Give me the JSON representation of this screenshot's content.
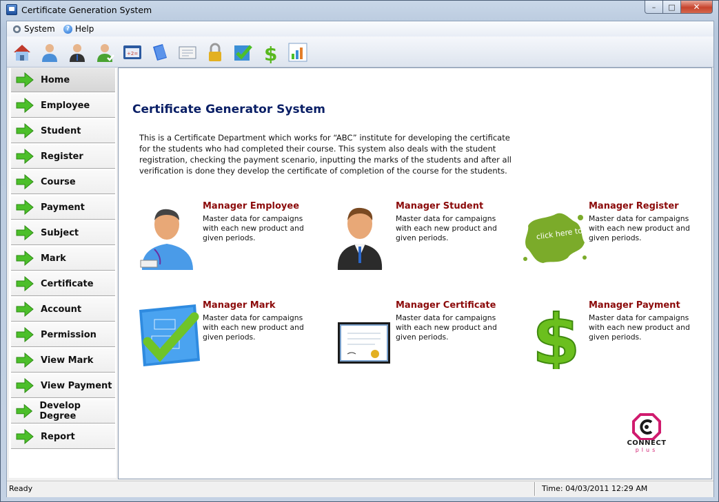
{
  "window": {
    "title": "Certificate Generation System",
    "controls": {
      "minimize": "–",
      "maximize": "□",
      "close": "✕"
    }
  },
  "menu": [
    {
      "label": "System",
      "icon": "gear-icon"
    },
    {
      "label": "Help",
      "icon": "help-icon"
    }
  ],
  "toolbar": [
    {
      "icon": "home-icon"
    },
    {
      "icon": "employee-icon"
    },
    {
      "icon": "student-icon"
    },
    {
      "icon": "register-icon"
    },
    {
      "icon": "course-icon"
    },
    {
      "icon": "book-icon"
    },
    {
      "icon": "certificate-icon"
    },
    {
      "icon": "lock-icon"
    },
    {
      "icon": "mark-check-icon"
    },
    {
      "icon": "dollar-icon"
    },
    {
      "icon": "chart-icon"
    }
  ],
  "sidebar": {
    "items": [
      {
        "label": "Home",
        "active": true
      },
      {
        "label": "Employee"
      },
      {
        "label": "Student"
      },
      {
        "label": "Register"
      },
      {
        "label": "Course"
      },
      {
        "label": "Payment"
      },
      {
        "label": "Subject"
      },
      {
        "label": "Mark"
      },
      {
        "label": "Certificate"
      },
      {
        "label": "Account"
      },
      {
        "label": "Permission"
      },
      {
        "label": "View Mark"
      },
      {
        "label": "View Payment"
      },
      {
        "label": "Develop Degree"
      },
      {
        "label": "Report"
      }
    ]
  },
  "main": {
    "title": "Certificate Generator System",
    "intro": "This is a Certificate Department which works for “ABC” institute for developing the certificate for the students who had completed their course. This system also deals with the student registration, checking the payment scenario, inputting the marks of the students and after all verification is done they develop the certificate of completion of the course for the students.",
    "cards": [
      {
        "title": "Manager Employee",
        "desc": "Master data for campaigns with each new product and given periods.",
        "icon": "employee-avatar-icon"
      },
      {
        "title": "Manager Student",
        "desc": "Master data for campaigns with each new product and given periods.",
        "icon": "student-avatar-icon"
      },
      {
        "title": "Manager Register",
        "desc": "Master data for campaigns with each new product and given periods.",
        "icon": "click-here-to-register-splash-icon",
        "icon_text": "click here to register"
      },
      {
        "title": "Manager Mark",
        "desc": "Master data for campaigns with each new product and given periods.",
        "icon": "blueprint-check-icon"
      },
      {
        "title": "Manager Certificate",
        "desc": "Master data for campaigns with each new product and given periods.",
        "icon": "certificate-frame-icon"
      },
      {
        "title": "Manager Payment",
        "desc": "Master data for campaigns with each new product and given periods.",
        "icon": "green-dollar-icon"
      }
    ],
    "logo": {
      "text": "CONNECT",
      "sub": "plus"
    }
  },
  "status": {
    "left": "Ready",
    "right": "Time: 04/03/2011 12:29 AM"
  },
  "colors": {
    "title_blue": "#0a1f66",
    "card_title_red": "#8b0a0a",
    "arrow_green": "#4cbf2a",
    "logo_pink": "#d01b6e"
  }
}
